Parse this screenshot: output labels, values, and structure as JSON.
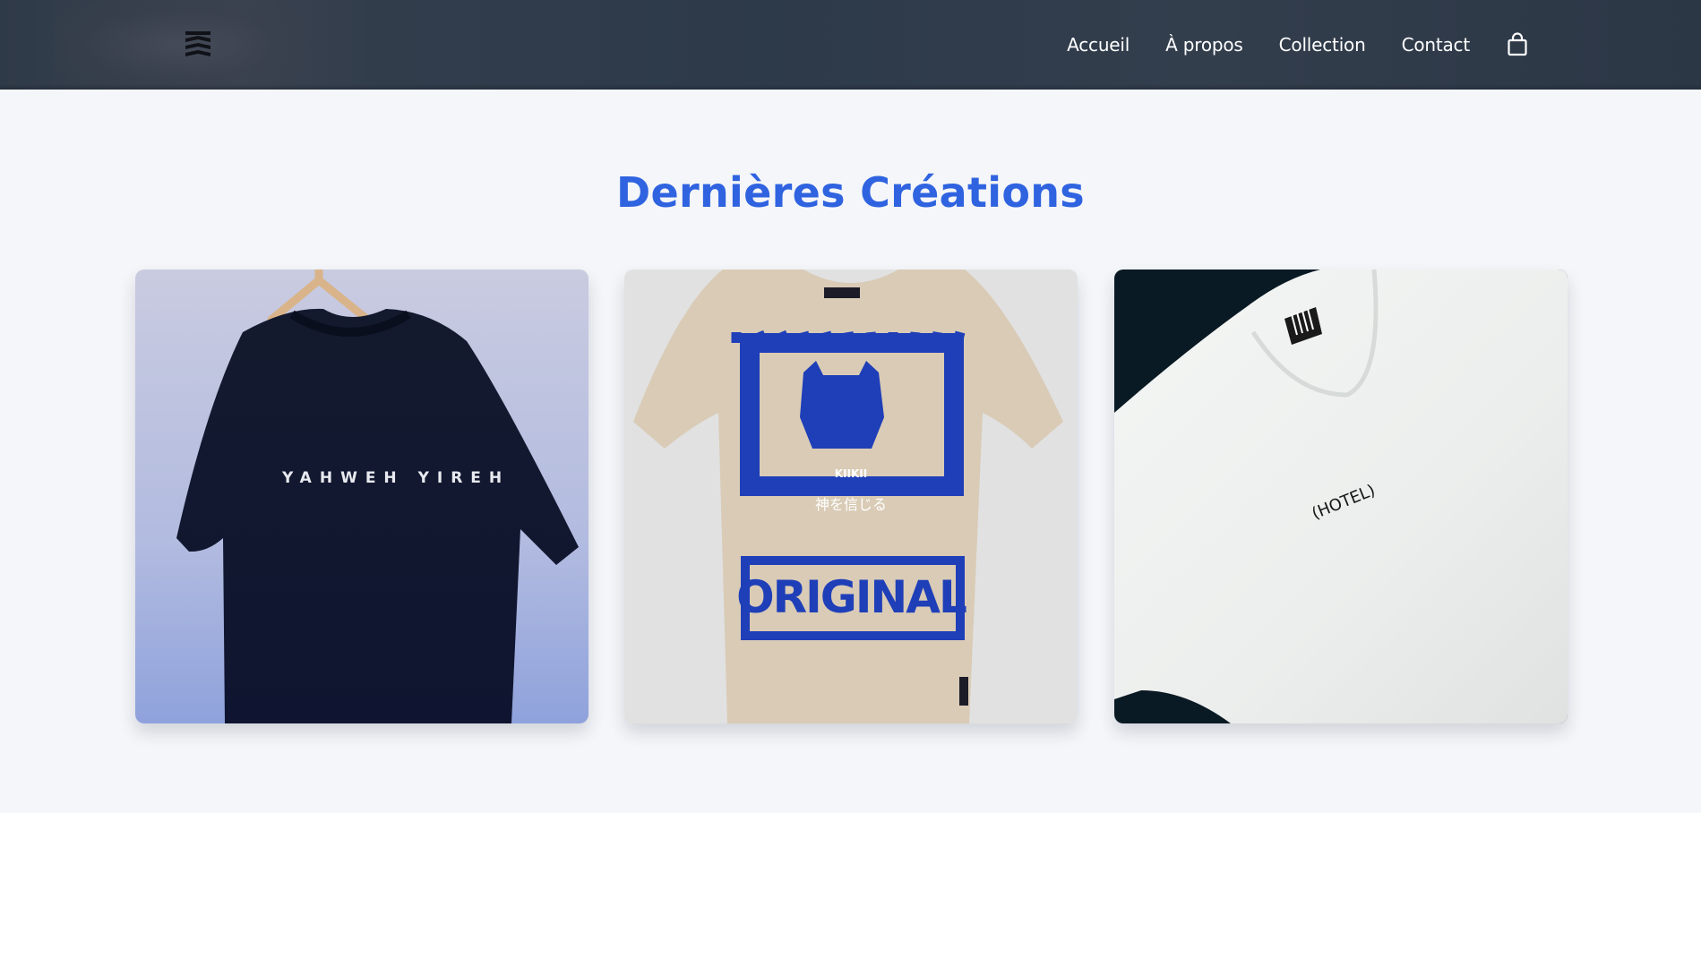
{
  "header": {
    "logo_icon": "stacked-chevrons-logo-icon",
    "nav": [
      {
        "label": "Accueil"
      },
      {
        "label": "À propos"
      },
      {
        "label": "Collection"
      },
      {
        "label": "Contact"
      }
    ],
    "cart_icon": "shopping-bag-icon"
  },
  "main": {
    "title": "Dernières Créations",
    "title_color": "#2f63e0",
    "products": [
      {
        "image_text": "YAHWEH YIREH",
        "shirt_color": "navy"
      },
      {
        "image_text_top": "KIIKII",
        "image_text_jp": "神を信じる",
        "image_text_bottom": "ORIGINAL",
        "shirt_color": "beige",
        "print_color": "#1f3fb8"
      },
      {
        "image_text": "(HOTEL)",
        "shirt_color": "white"
      }
    ]
  },
  "colors": {
    "header_bg": "#2f3a48",
    "section_bg": "#f4f6f9",
    "accent": "#2f63e0"
  }
}
